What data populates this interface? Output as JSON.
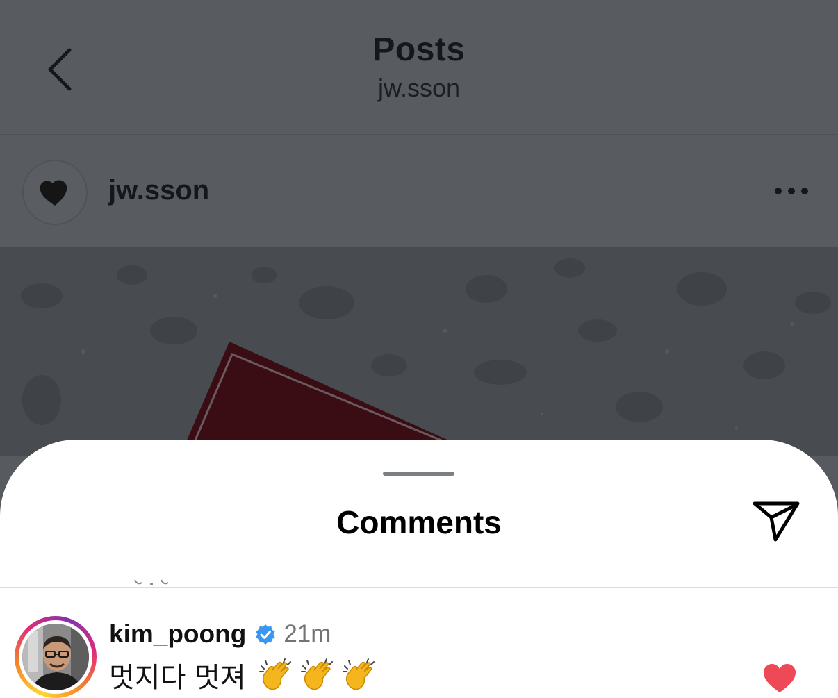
{
  "header": {
    "title": "Posts",
    "subtitle": "jw.sson",
    "back_icon": "chevron-left-icon"
  },
  "post": {
    "author": "jw.sson",
    "more_icon": "more-horizontal-icon"
  },
  "sheet": {
    "title": "Comments",
    "share_icon": "send-icon"
  },
  "comment": {
    "username": "kim_poong",
    "verified_icon": "verified-badge-icon",
    "time": "21m",
    "text": "멋지다 멋져",
    "emojis": [
      "clapping-hands-icon",
      "clapping-hands-icon",
      "clapping-hands-icon"
    ],
    "like_icon": "heart-filled-icon",
    "liked": true
  },
  "colors": {
    "overlay_dim": "#575b5f",
    "verified_blue": "#3897f0",
    "heart_red": "#ed4956",
    "sheet_bg": "#ffffff"
  }
}
